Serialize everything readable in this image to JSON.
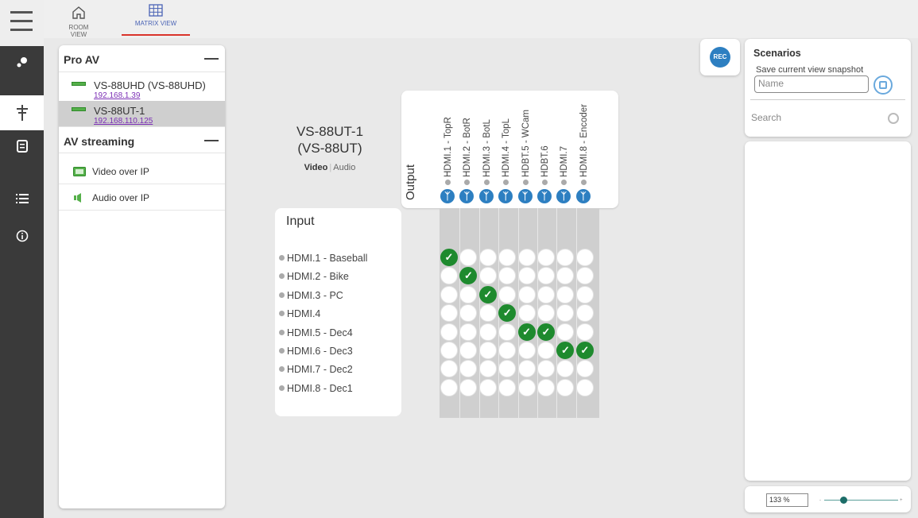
{
  "nav": {
    "room_view": "ROOM VIEW",
    "matrix_view": "MATRIX VIEW"
  },
  "panel": {
    "pro_av": "Pro AV",
    "devices": [
      {
        "name": "VS-88UHD (VS-88UHD)",
        "ip": "192.168.1.39"
      },
      {
        "name": "VS-88UT-1",
        "ip": "192.168.110.125"
      }
    ],
    "av_streaming": "AV streaming",
    "streams": [
      "Video over IP",
      "Audio over IP"
    ]
  },
  "device_title": {
    "line1": "VS-88UT-1",
    "line2": "(VS-88UT)",
    "video": "Video",
    "sep": "|",
    "audio": "Audio"
  },
  "matrix": {
    "output_label": "Output",
    "input_label": "Input",
    "outputs": [
      "HDMI.1 - TopR",
      "HDMI.2 - BotR",
      "HDMI.3 - BotL",
      "HDMI.4 - TopL",
      "HDBT.5 - WCam",
      "HDBT.6",
      "HDMI.7",
      "HDMI.8 - Encoder"
    ],
    "inputs": [
      "HDMI.1 - Baseball",
      "HDMI.2 - Bike",
      "HDMI.3 - PC",
      "HDMI.4",
      "HDMI.5 - Dec4",
      "HDMI.6 - Dec3",
      "HDMI.7 - Dec2",
      "HDMI.8 - Dec1"
    ],
    "routes": [
      [
        0,
        0
      ],
      [
        1,
        1
      ],
      [
        2,
        2
      ],
      [
        3,
        3
      ],
      [
        4,
        4
      ],
      [
        4,
        5
      ],
      [
        5,
        6
      ],
      [
        5,
        7
      ]
    ]
  },
  "scenarios": {
    "title": "Scenarios",
    "save_label": "Save current view snapshot",
    "name_placeholder": "Name",
    "search_placeholder": "Search",
    "rec": "REC"
  },
  "zoom": {
    "value": "133 %",
    "minus": "-",
    "plus": "+"
  }
}
